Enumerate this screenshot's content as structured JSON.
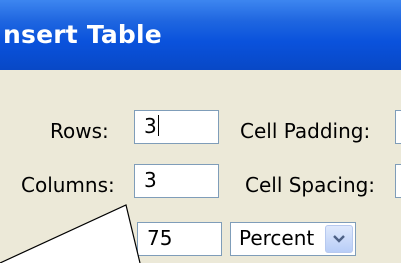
{
  "dialog": {
    "title": "nsert Table",
    "rows_label": "Rows:",
    "rows_value": "3",
    "columns_label": "Columns:",
    "columns_value": "3",
    "width_value": "75",
    "width_unit": "Percent",
    "cell_padding_label": "Cell Padding:",
    "cell_spacing_label": "Cell Spacing:"
  },
  "colors": {
    "titlebar": "#0a52dc",
    "dialog_background": "#ece9d8",
    "field_border": "#7f9db9"
  },
  "icons": {
    "dropdown": "chevron-down-icon"
  }
}
